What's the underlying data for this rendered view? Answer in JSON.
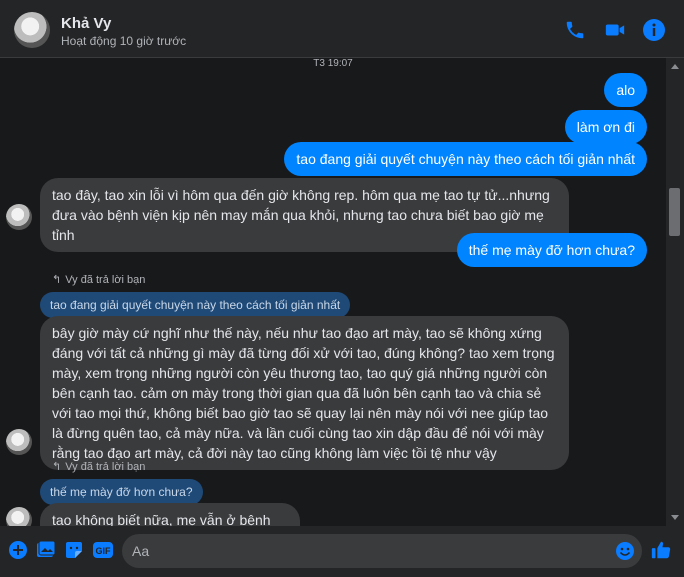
{
  "header": {
    "name": "Khả Vy",
    "status": "Hoạt động 10 giờ trước"
  },
  "chat": {
    "timestamp": "T3 19:07",
    "out1": "alo",
    "out2": "làm ơn đi",
    "out3": "tao đang giải quyết chuyện này theo cách tối giản nhất",
    "in1": "tao đây, tao xin lỗi vì hôm qua đến giờ không rep. hôm qua mẹ tao tự tử...nhưng đưa vào bệnh viện kịp nên may mắn qua khỏi, nhưng tao chưa biết bao giờ mẹ tỉnh",
    "out4": "thế mẹ mày đỡ hơn chưa?",
    "reply1_line": "Vy đã trả lời bạn",
    "reply1_quote": "tao đang giải quyết chuyện này theo cách tối giản nhất",
    "in2": "bây giờ mày cứ nghĩ như thế này, nếu như tao đạo art mày, tao sẽ không xứng đáng với tất cả những gì mày đã từng đối xử với tao, đúng không? tao xem trọng mày, xem trọng những người còn yêu thương tao, tao quý giá những người còn bên cạnh tao. cảm ơn mày trong thời gian qua đã luôn bên cạnh tao và chia sẻ với tao mọi thứ, không biết bao giờ tao sẽ quay lại nên mày nói với nee giúp tao là đừng quên tao, cả mày nữa. và lần cuối cùng tao xin dập đầu để nói với mày rằng tao đạo art mày, cả đời này tao cũng không làm việc tồi tệ như vậy",
    "reply2_line": "Vy đã trả lời bạn",
    "reply2_quote": "thế mẹ mày đỡ hơn chưa?",
    "in3": "tao không biết nữa, mẹ vẫn ở bệnh viện"
  },
  "composer": {
    "placeholder": "Aa"
  },
  "colors": {
    "accent": "#0084ff",
    "background": "#18191a",
    "incoming_bubble": "#3a3b3c",
    "quote_bubble": "#1f4a78"
  },
  "icons": [
    "phone-icon",
    "video-icon",
    "info-icon",
    "plus-icon",
    "image-icon",
    "sticker-icon",
    "gif-icon",
    "emoji-icon",
    "like-icon"
  ]
}
